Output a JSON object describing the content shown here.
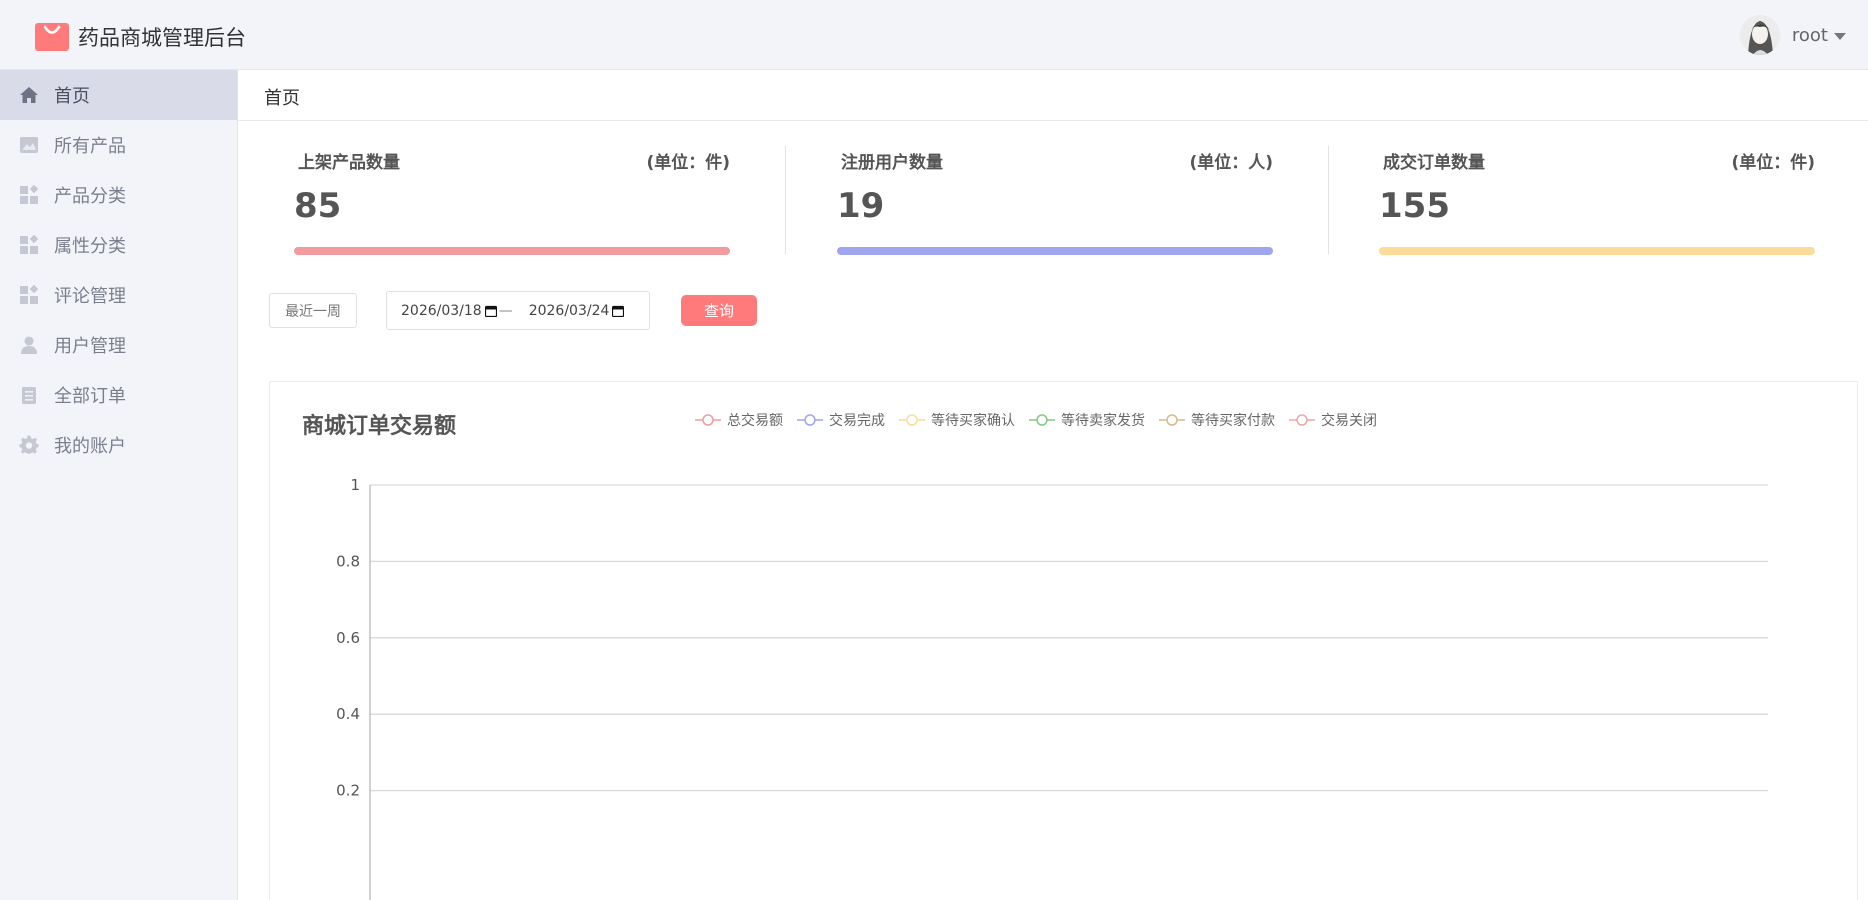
{
  "header": {
    "app_title": "药品商城管理后台",
    "user_name": "root",
    "brand_color": "#ff7b7b"
  },
  "sidebar": {
    "items": [
      {
        "label": "首页",
        "icon": "home-icon",
        "active": true
      },
      {
        "label": "所有产品",
        "icon": "image-icon",
        "active": false
      },
      {
        "label": "产品分类",
        "icon": "category-icon",
        "active": false
      },
      {
        "label": "属性分类",
        "icon": "category-icon",
        "active": false
      },
      {
        "label": "评论管理",
        "icon": "category-icon",
        "active": false
      },
      {
        "label": "用户管理",
        "icon": "user-icon",
        "active": false
      },
      {
        "label": "全部订单",
        "icon": "clipboard-icon",
        "active": false
      },
      {
        "label": "我的账户",
        "icon": "gear-icon",
        "active": false
      }
    ]
  },
  "breadcrumb": {
    "current": "首页"
  },
  "stats": [
    {
      "label": "上架产品数量",
      "unit": "(单位：件)",
      "value": "85",
      "color": "#f29b9f"
    },
    {
      "label": "注册用户数量",
      "unit": "(单位：人)",
      "value": "19",
      "color": "#9fa6ee"
    },
    {
      "label": "成交订单数量",
      "unit": "(单位：件)",
      "value": "155",
      "color": "#fcdc98"
    }
  ],
  "filter": {
    "week_button": "最近一周",
    "start_date": "2026/03/18",
    "end_date": "2026/03/24",
    "separator": "—",
    "query_button": "查询"
  },
  "chart_data": {
    "type": "line",
    "title": "商城订单交易额",
    "xlabel": "",
    "ylabel": "",
    "ylim": [
      0,
      1
    ],
    "yticks": [
      "1",
      "0.8",
      "0.6",
      "0.4",
      "0.2"
    ],
    "grid": true,
    "legend_position": "top",
    "series": [
      {
        "name": "总交易额",
        "color": "#f29b9f",
        "values": []
      },
      {
        "name": "交易完成",
        "color": "#9fa6ee",
        "values": []
      },
      {
        "name": "等待买家确认",
        "color": "#fcdc98",
        "values": []
      },
      {
        "name": "等待卖家发货",
        "color": "#86c784",
        "values": []
      },
      {
        "name": "等待买家付款",
        "color": "#d7b98e",
        "values": []
      },
      {
        "name": "交易关闭",
        "color": "#f2a6a6",
        "values": []
      }
    ]
  }
}
